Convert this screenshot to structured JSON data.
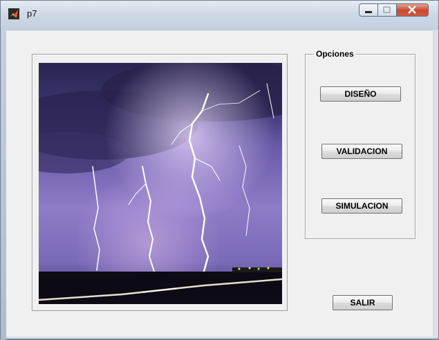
{
  "window": {
    "title": "p7"
  },
  "group": {
    "title": "Opciones"
  },
  "buttons": {
    "design": "DISEÑO",
    "validation": "VALIDACION",
    "simulation": "SIMULACION",
    "exit": "SALIR"
  },
  "colors": {
    "titlebar": "#cfd9e5",
    "close": "#c74832",
    "panel": "#f0f0f0"
  },
  "icons": {
    "app": "matlab-icon",
    "minimize": "minimize-icon",
    "maximize": "maximize-icon",
    "close": "close-icon"
  }
}
